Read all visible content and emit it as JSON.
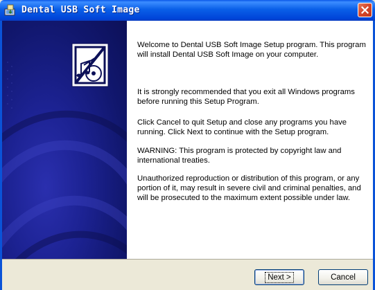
{
  "window": {
    "title": "Dental USB Soft Image",
    "icons": {
      "app": "setup-installer-icon",
      "close": "close-icon"
    }
  },
  "side_panel": {
    "logo_icon": "music-cd-logo-icon"
  },
  "content": {
    "paragraphs": [
      "Welcome to Dental USB Soft Image Setup program. This program will install Dental USB Soft Image on your computer.",
      "It is strongly recommended that you exit all Windows programs before running this Setup Program.",
      "Click Cancel to quit Setup and close any programs you have running.  Click Next to continue with the Setup program.",
      "WARNING: This program is protected by copyright law and international treaties.",
      "Unauthorized reproduction or distribution of this program, or any portion of it, may result in severe civil and criminal penalties, and will be prosecuted to the maximum extent possible under law."
    ]
  },
  "buttons": {
    "next_label": "Next >",
    "cancel_label": "Cancel"
  },
  "colors": {
    "titlebar_blue": "#0a5fe8",
    "panel_navy": "#1c2292",
    "close_red": "#d6462a",
    "dialog_face": "#ece9d8"
  }
}
